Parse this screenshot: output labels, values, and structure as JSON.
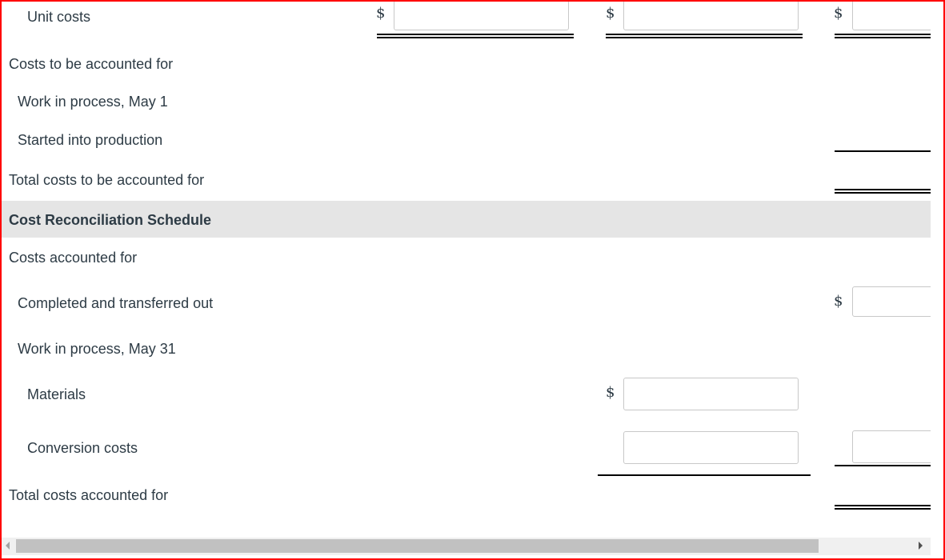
{
  "rows": {
    "unit_costs": "Unit costs",
    "costs_to_be_accounted_for": "Costs to be accounted for",
    "wip_may1": "Work in process, May 1",
    "started_into_production": "Started into production",
    "total_costs_to_be_accounted_for": "Total costs to be accounted for",
    "cost_reconciliation_schedule": "Cost Reconciliation Schedule",
    "costs_accounted_for": "Costs accounted for",
    "completed_and_transferred_out": "Completed and transferred out",
    "wip_may31": "Work in process, May 31",
    "materials": "Materials",
    "conversion_costs": "Conversion costs",
    "total_costs_accounted_for": "Total costs accounted for"
  },
  "currency_symbol": "$",
  "inputs": {
    "unit_cost_materials": "",
    "unit_cost_conversion": "",
    "unit_cost_total": "",
    "completed_transferred_out": "",
    "wip_materials": "",
    "wip_conversion": "",
    "wip_total": ""
  }
}
